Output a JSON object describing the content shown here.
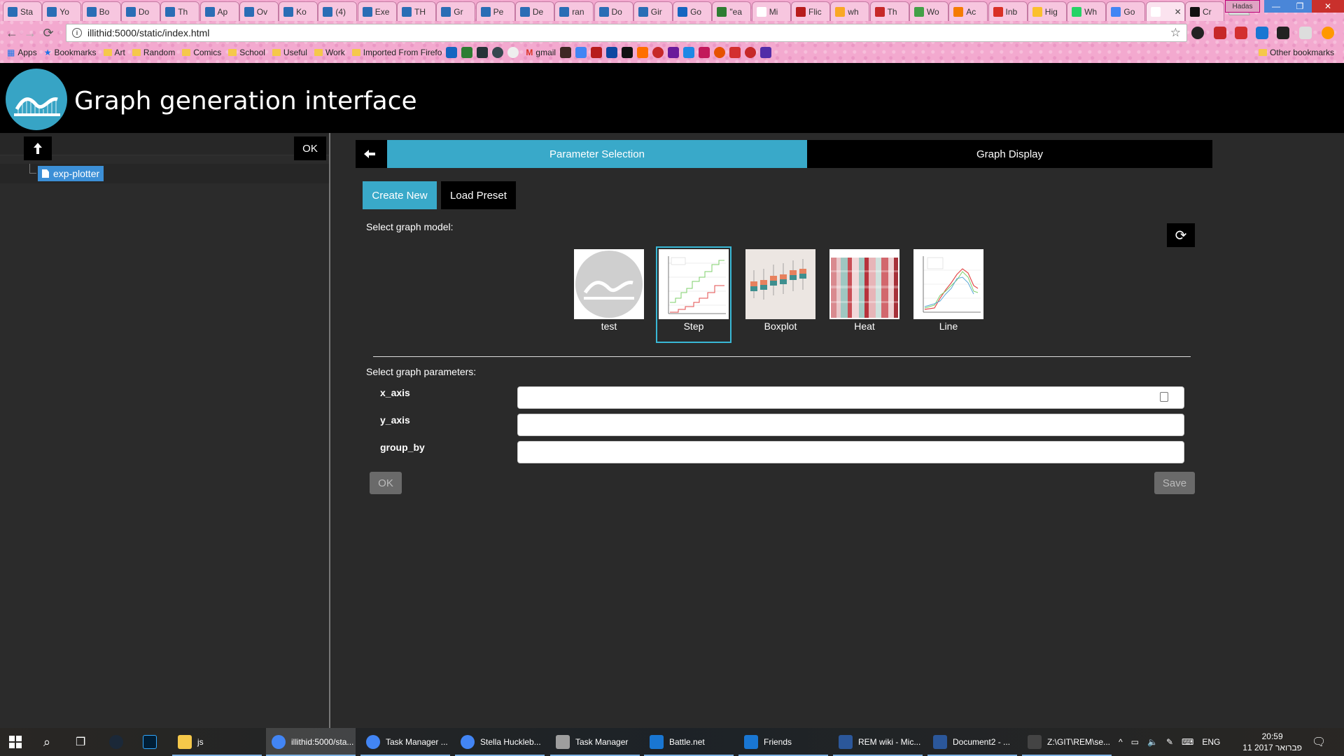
{
  "browser": {
    "tabs": [
      {
        "label": "Sta",
        "color": "#2a6db5"
      },
      {
        "label": "Yo",
        "color": "#2a6db5"
      },
      {
        "label": "Bo",
        "color": "#2a6db5"
      },
      {
        "label": "Do",
        "color": "#2a6db5"
      },
      {
        "label": "Th",
        "color": "#2a6db5"
      },
      {
        "label": "Ap",
        "color": "#2a6db5"
      },
      {
        "label": "Ov",
        "color": "#2a6db5"
      },
      {
        "label": "Ko",
        "color": "#2a6db5"
      },
      {
        "label": "(4)",
        "color": "#2a6db5"
      },
      {
        "label": "Exe",
        "color": "#2a6db5"
      },
      {
        "label": "TH",
        "color": "#2a6db5"
      },
      {
        "label": "Gr",
        "color": "#2a6db5"
      },
      {
        "label": "Pe",
        "color": "#2a6db5"
      },
      {
        "label": "De",
        "color": "#2a6db5"
      },
      {
        "label": "ran",
        "color": "#2a6db5"
      },
      {
        "label": "Do",
        "color": "#2a6db5"
      },
      {
        "label": "Gir",
        "color": "#2a6db5"
      },
      {
        "label": "Go",
        "color": "#1565c0"
      },
      {
        "label": "\"ea",
        "color": "#2e7d32"
      },
      {
        "label": "Mi",
        "color": "#ffffff"
      },
      {
        "label": "Flic",
        "color": "#b71c1c"
      },
      {
        "label": "wh",
        "color": "#f9a825"
      },
      {
        "label": "Th",
        "color": "#c62828"
      },
      {
        "label": "Wo",
        "color": "#43a047"
      },
      {
        "label": "Ac",
        "color": "#f57c00"
      },
      {
        "label": "Inb",
        "color": "#d93025"
      },
      {
        "label": "Hig",
        "color": "#fbc02d"
      },
      {
        "label": "Wh",
        "color": "#25d366"
      },
      {
        "label": "Go",
        "color": "#4285f4"
      },
      {
        "label": "",
        "color": "#ffffff"
      },
      {
        "label": "Cr",
        "color": "#111111"
      }
    ],
    "window_user": "Hadas",
    "url": "illithid:5000/static/index.html",
    "bookmarks": {
      "apps_label": "Apps",
      "items": [
        "Bookmarks",
        "Art",
        "Random",
        "Comics",
        "School",
        "Useful",
        "Work",
        "Imported From Firefo"
      ],
      "gmail_label": "gmail",
      "other_label": "Other bookmarks"
    }
  },
  "app": {
    "title": "Graph generation interface"
  },
  "left_panel": {
    "ok_label": "OK",
    "tree": {
      "node_label": "exp-plotter"
    }
  },
  "tabs": {
    "parameter_selection": "Parameter Selection",
    "graph_display": "Graph Display"
  },
  "actions": {
    "create_new": "Create New",
    "load_preset": "Load Preset"
  },
  "model_section": {
    "label": "Select graph model:",
    "models": [
      {
        "name": "test",
        "selected": false
      },
      {
        "name": "Step",
        "selected": true
      },
      {
        "name": "Boxplot",
        "selected": false
      },
      {
        "name": "Heat",
        "selected": false
      },
      {
        "name": "Line",
        "selected": false
      }
    ]
  },
  "params_section": {
    "label": "Select graph parameters:",
    "params": [
      {
        "name": "x_axis",
        "value": ""
      },
      {
        "name": "y_axis",
        "value": ""
      },
      {
        "name": "group_by",
        "value": ""
      }
    ],
    "ok_label": "OK",
    "save_label": "Save"
  },
  "taskbar": {
    "items": [
      {
        "label": "js",
        "color": "#f5c84a"
      },
      {
        "label": "illithid:5000/sta...",
        "color": "#4285f4"
      },
      {
        "label": "Task Manager ...",
        "color": "#4285f4"
      },
      {
        "label": "Stella Huckleb...",
        "color": "#4285f4"
      },
      {
        "label": "Task Manager",
        "color": "#9e9e9e"
      },
      {
        "label": "Battle.net",
        "color": "#1976d2"
      },
      {
        "label": "Friends",
        "color": "#1976d2"
      },
      {
        "label": "REM wiki - Mic...",
        "color": "#2b579a"
      },
      {
        "label": "Document2 - ...",
        "color": "#2b579a"
      },
      {
        "label": "Z:\\GIT\\REM\\se...",
        "color": "#444444"
      }
    ],
    "language": "ENG",
    "time": "20:59",
    "date": "11 פברואר 2017"
  },
  "colors": {
    "accent": "#39a9c9",
    "header_bg": "#000000",
    "panel_bg": "#2a2a2a"
  }
}
